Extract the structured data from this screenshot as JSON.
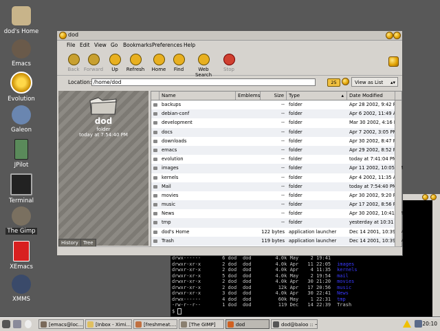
{
  "desktop": {
    "icons": [
      {
        "label": "dod's Home",
        "icon": "home-icon"
      },
      {
        "label": "Emacs",
        "icon": "emacs-gnu-icon"
      },
      {
        "label": "Evolution",
        "icon": "evolution-icon"
      },
      {
        "label": "Galeon",
        "icon": "galeon-icon"
      },
      {
        "label": "JPilot",
        "icon": "palm-pilot-icon"
      },
      {
        "label": "Terminal",
        "icon": "terminal-icon"
      },
      {
        "label": "The Gimp",
        "icon": "gimp-icon"
      },
      {
        "label": "XEmacs",
        "icon": "xemacs-icon"
      },
      {
        "label": "XMMS",
        "icon": "xmms-icon"
      }
    ]
  },
  "window": {
    "title": "dod",
    "menu": [
      "File",
      "Edit",
      "View",
      "Go",
      "Bookmarks",
      "Preferences",
      "Help"
    ],
    "toolbar": {
      "back": "Back",
      "forward": "Forward",
      "up": "Up",
      "refresh": "Refresh",
      "home": "Home",
      "find": "Find",
      "web_search": "Web Search",
      "stop": "Stop"
    },
    "location_label": "Location:",
    "location_value": "/home/dod",
    "zoom_value": "25",
    "view_as": "View as List",
    "sidebar": {
      "name": "dod",
      "kind": "folder",
      "date": "today at 7:54:40 PM",
      "tabs": [
        "History",
        "Tree"
      ]
    },
    "columns": [
      "Name",
      "Emblems",
      "Size",
      "Type",
      "Date Modified"
    ],
    "files": [
      {
        "name": "backups",
        "size": "--",
        "type": "folder",
        "date": "Apr 28 2002, 9:42 PM"
      },
      {
        "name": "debian-conf",
        "size": "--",
        "type": "folder",
        "date": "Apr 6 2002, 11:49 AM"
      },
      {
        "name": "development",
        "size": "--",
        "type": "folder",
        "date": "Mar 30 2002, 4:16 PM"
      },
      {
        "name": "docs",
        "size": "--",
        "type": "folder",
        "date": "Apr 7 2002, 3:05 PM"
      },
      {
        "name": "downloads",
        "size": "--",
        "type": "folder",
        "date": "Apr 30 2002, 8:47 PM"
      },
      {
        "name": "emacs",
        "size": "--",
        "type": "folder",
        "date": "Apr 29 2002, 8:52 PM"
      },
      {
        "name": "evolution",
        "size": "--",
        "type": "folder",
        "date": "today at 7:41:04 PM"
      },
      {
        "name": "images",
        "size": "--",
        "type": "folder",
        "date": "Apr 11 2002, 10:05 PM"
      },
      {
        "name": "kernels",
        "size": "--",
        "type": "folder",
        "date": "Apr 4 2002, 11:35 AM"
      },
      {
        "name": "Mail",
        "size": "--",
        "type": "folder",
        "date": "today at 7:54:40 PM"
      },
      {
        "name": "movies",
        "size": "--",
        "type": "folder",
        "date": "Apr 30 2002, 9:20 PM"
      },
      {
        "name": "music",
        "size": "--",
        "type": "folder",
        "date": "Apr 17 2002, 8:56 PM"
      },
      {
        "name": "News",
        "size": "--",
        "type": "folder",
        "date": "Apr 30 2002, 10:41 PM"
      },
      {
        "name": "tmp",
        "size": "--",
        "type": "folder",
        "date": "yesterday at 10:31 PM"
      },
      {
        "name": "dod's Home",
        "size": "122 bytes",
        "type": "application launcher",
        "date": "Dec 14 2001, 10:39 PM"
      },
      {
        "name": "Trash",
        "size": "119 bytes",
        "type": "application launcher",
        "date": "Dec 14 2001, 10:39 PM"
      }
    ]
  },
  "terminal": {
    "lines": [
      {
        "perm": "drwxr-xr-x",
        "links": "2",
        "user": "dod",
        "group": "dod",
        "size": "4.0k",
        "mon": "Apr",
        "day": "11",
        "time": "22:05",
        "name": "images"
      },
      {
        "perm": "drwxr-xr-x",
        "links": "2",
        "user": "dod",
        "group": "dod",
        "size": "4.0k",
        "mon": "Apr",
        "day": "4",
        "time": "11:35",
        "name": "kernels"
      },
      {
        "perm": "drwxr-xr-x",
        "links": "5",
        "user": "dod",
        "group": "dod",
        "size": "4.0k",
        "mon": "May",
        "day": "2",
        "time": "19:54",
        "name": "mail"
      },
      {
        "perm": "drwxr-xr-x",
        "links": "2",
        "user": "dod",
        "group": "dod",
        "size": "4.0k",
        "mon": "Apr",
        "day": "30",
        "time": "21:20",
        "name": "movies"
      },
      {
        "perm": "drwxr-xr-x",
        "links": "2",
        "user": "dod",
        "group": "dod",
        "size": "12k",
        "mon": "Apr",
        "day": "17",
        "time": "20:56",
        "name": "music"
      },
      {
        "perm": "drwxr-xr-x",
        "links": "3",
        "user": "dod",
        "group": "dod",
        "size": "4.0k",
        "mon": "Apr",
        "day": "30",
        "time": "22:41",
        "name": "News"
      },
      {
        "perm": "drwx------",
        "links": "4",
        "user": "dod",
        "group": "dod",
        "size": "60k",
        "mon": "May",
        "day": "1",
        "time": "22:31",
        "name": "tmp"
      },
      {
        "perm": "-rw-r--r--",
        "links": "1",
        "user": "dod",
        "group": "dod",
        "size": "119",
        "mon": "Dec",
        "day": "14",
        "time": "22:39",
        "name": "Trash"
      }
    ],
    "top_partial_line": {
      "perm": "drwx------",
      "links": "6",
      "user": "dod",
      "group": "dod",
      "size": "4.0k",
      "mon": "May",
      "day": "2",
      "time": "19:41"
    },
    "prompt": "$ "
  },
  "taskbar": {
    "tasks": [
      {
        "label": "[emacs@loc...]"
      },
      {
        "label": "[Inbox - Ximi...]"
      },
      {
        "label": "[freshmeat....]"
      },
      {
        "label": "[The GIMP]"
      },
      {
        "label": "dod"
      },
      {
        "label": "dod@baloo :: ~"
      }
    ],
    "clock": "20:10"
  }
}
